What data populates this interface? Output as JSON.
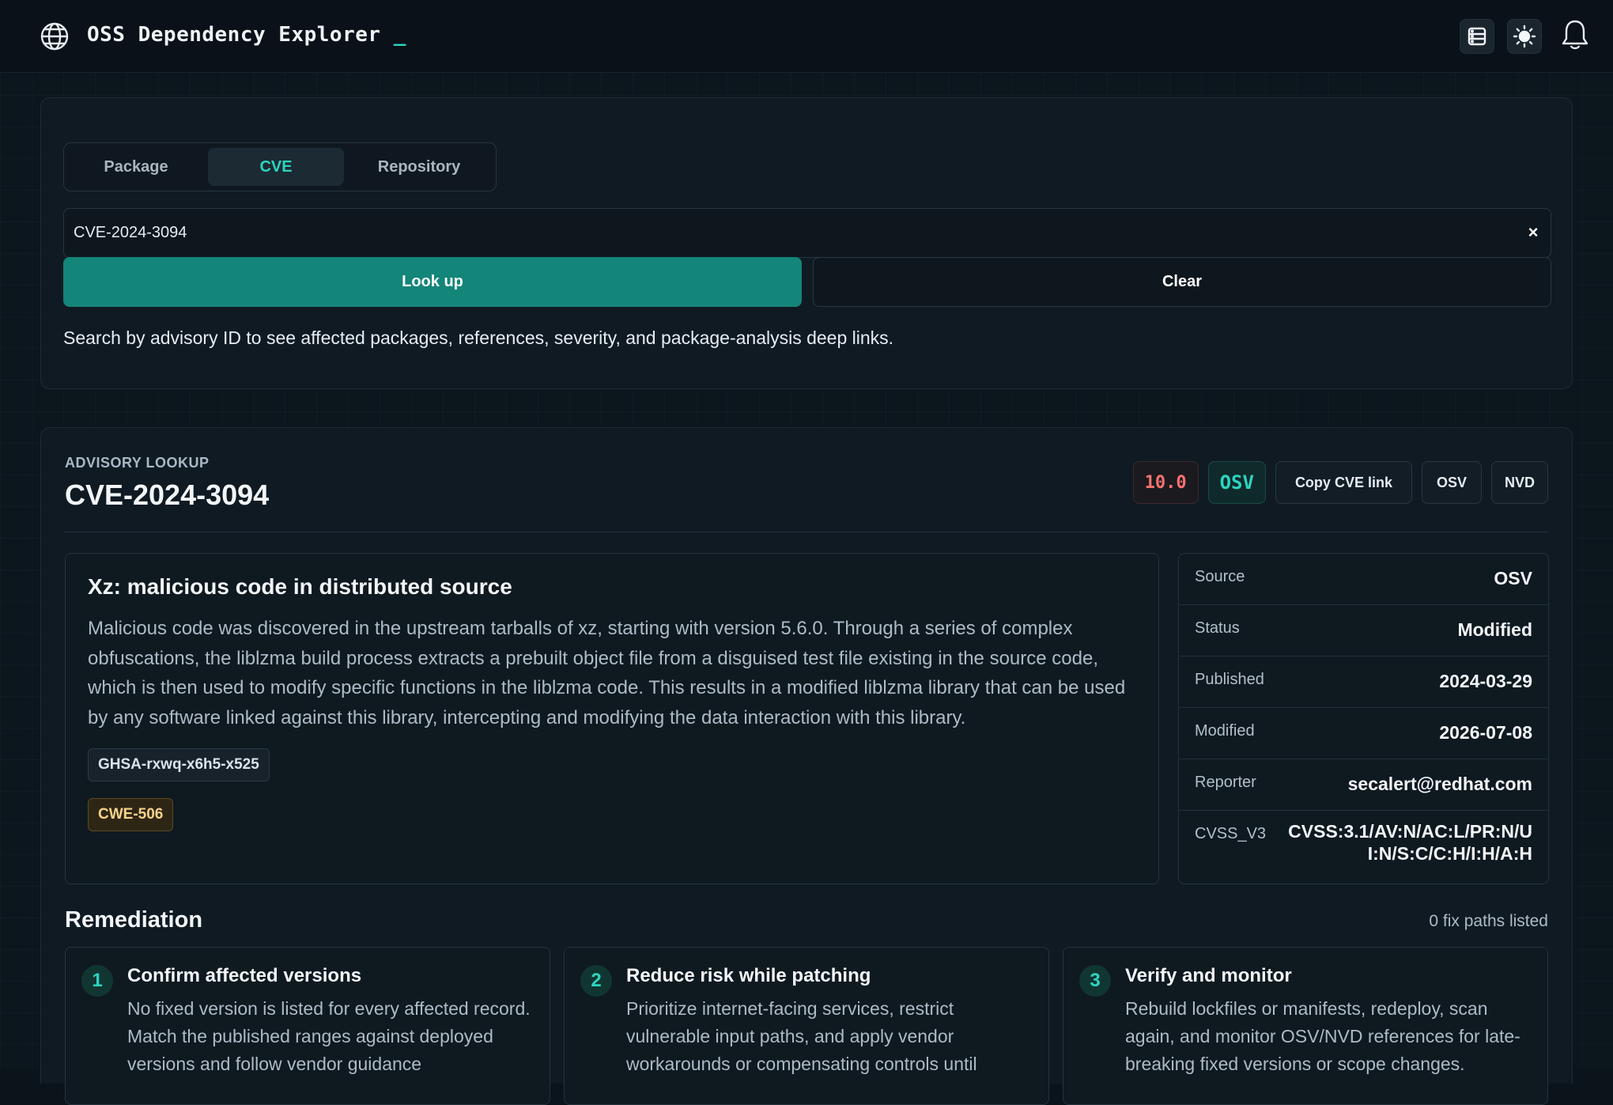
{
  "header": {
    "title": "OSS Dependency Explorer",
    "cursor": "_",
    "icons": [
      "globe-icon",
      "database-icon",
      "sun-icon",
      "bell-icon"
    ]
  },
  "search": {
    "tabs": [
      {
        "label": "Package",
        "active": false
      },
      {
        "label": "CVE",
        "active": true
      },
      {
        "label": "Repository",
        "active": false
      }
    ],
    "input_value": "CVE-2024-3094",
    "clear_icon": "×",
    "lookup_label": "Look up",
    "clear_label": "Clear",
    "hint": "Search by advisory ID to see affected packages, references, severity, and package-analysis deep links."
  },
  "advisory": {
    "kicker": "ADVISORY LOOKUP",
    "id": "CVE-2024-3094",
    "score": "10.0",
    "source_badge": "OSV",
    "actions": {
      "copy": "Copy CVE link",
      "osv": "OSV",
      "nvd": "NVD"
    },
    "summary_title": "Xz: malicious code in distributed source",
    "summary_text": "Malicious code was discovered in the upstream tarballs of xz, starting with version 5.6.0. Through a series of complex obfuscations, the liblzma build process extracts a prebuilt object file from a disguised test file existing in the source code, which is then used to modify specific functions in the liblzma code. This results in a modified liblzma library that can be used by any software linked against this library, intercepting and modifying the data interaction with this library.",
    "alias": "GHSA-rxwq-x6h5-x525",
    "cwe": "CWE-506",
    "meta": [
      {
        "key": "Source",
        "value": "OSV"
      },
      {
        "key": "Status",
        "value": "Modified"
      },
      {
        "key": "Published",
        "value": "2024-03-29"
      },
      {
        "key": "Modified",
        "value": "2026-07-08"
      },
      {
        "key": "Reporter",
        "value": "secalert@redhat.com"
      },
      {
        "key": "CVSS_V3",
        "value": "CVSS:3.1/AV:N/AC:L/PR:N/UI:N/S:C/C:H/I:H/A:H"
      }
    ]
  },
  "remediation": {
    "title": "Remediation",
    "count": "0 fix paths listed",
    "steps": [
      {
        "num": "1",
        "title": "Confirm affected versions",
        "text": "No fixed version is listed for every affected record. Match the published ranges against deployed versions and follow vendor guidance"
      },
      {
        "num": "2",
        "title": "Reduce risk while patching",
        "text": "Prioritize internet-facing services, restrict vulnerable input paths, and apply vendor workarounds or compensating controls until"
      },
      {
        "num": "3",
        "title": "Verify and monitor",
        "text": "Rebuild lockfiles or manifests, redeploy, scan again, and monitor OSV/NVD references for late-breaking fixed versions or scope changes."
      }
    ]
  },
  "colors": {
    "accent": "#2dd4bf",
    "primary_button": "#138579",
    "score": "#f87171",
    "cwe_tag": "#f7d38a"
  }
}
